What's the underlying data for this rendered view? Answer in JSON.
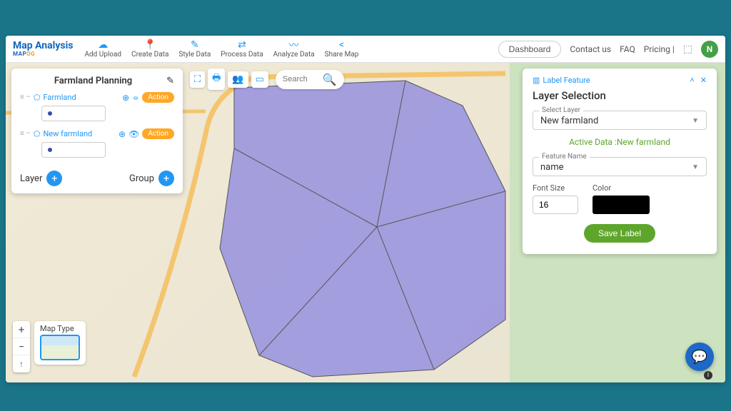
{
  "logo": {
    "title": "Map Analysis",
    "sub_a": "MAP",
    "sub_b": "OG"
  },
  "nav": [
    {
      "label": "Add Upload",
      "icon": "☁"
    },
    {
      "label": "Create Data",
      "icon": "📍"
    },
    {
      "label": "Style Data",
      "icon": "✎"
    },
    {
      "label": "Process Data",
      "icon": "⇄"
    },
    {
      "label": "Analyze Data",
      "icon": "〰"
    },
    {
      "label": "Share Map",
      "icon": "<"
    }
  ],
  "header_right": {
    "dashboard": "Dashboard",
    "contact": "Contact us",
    "faq": "FAQ",
    "pricing": "Pricing |",
    "avatar": "N"
  },
  "toolbar_icons": [
    "⛶",
    "🖶",
    "👥",
    "▭"
  ],
  "search_placeholder": "Search",
  "layers_panel": {
    "title": "Farmland Planning",
    "layers": [
      {
        "name": "Farmland",
        "visible": false
      },
      {
        "name": "New farmland",
        "visible": true
      }
    ],
    "action_label": "Action",
    "layer_btn": "Layer",
    "group_btn": "Group"
  },
  "label_panel": {
    "tab_label": "Label Feature",
    "title": "Layer Selection",
    "select_layer_label": "Select Layer",
    "select_layer_value": "New farmland",
    "active_data_prefix": "Active Data :",
    "active_data_value": "New farmland",
    "feature_name_label": "Feature Name",
    "feature_name_value": "name",
    "font_size_label": "Font Size",
    "font_size_value": "16",
    "color_label": "Color",
    "color_value": "#000000",
    "save_label": "Save Label"
  },
  "map_controls": {
    "map_type_label": "Map Type"
  }
}
